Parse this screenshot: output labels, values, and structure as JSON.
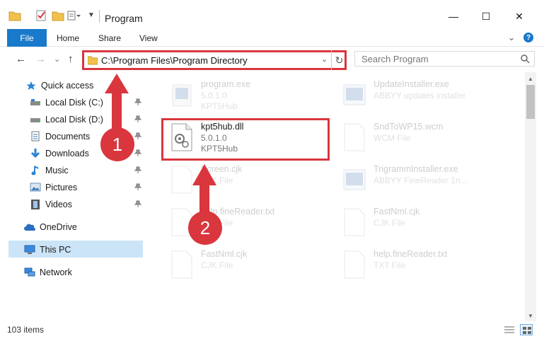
{
  "window": {
    "title": "Program",
    "minimize": "—",
    "maximize": "☐",
    "close": "✕"
  },
  "ribbon": {
    "tabs": [
      "File",
      "Home",
      "Share",
      "View"
    ],
    "expand": "⌄",
    "help": "?"
  },
  "nav": {
    "back": "←",
    "forward": "→",
    "recent": "⌄",
    "up": "↑",
    "address": "C:\\Program Files\\Program Directory",
    "address_dropdown": "⌄",
    "refresh": "↻",
    "search_placeholder": "Search Program"
  },
  "sidebar": {
    "quick_access": "Quick access",
    "items": [
      {
        "label": "Local Disk (C:)",
        "icon": "drive-icon"
      },
      {
        "label": "Local Disk (D:)",
        "icon": "drive-icon"
      },
      {
        "label": "Documents",
        "icon": "documents-icon"
      },
      {
        "label": "Downloads",
        "icon": "downloads-icon"
      },
      {
        "label": "Music",
        "icon": "music-icon"
      },
      {
        "label": "Pictures",
        "icon": "pictures-icon"
      },
      {
        "label": "Videos",
        "icon": "videos-icon"
      }
    ],
    "onedrive": "OneDrive",
    "thispc": "This PC",
    "network": "Network",
    "pin": "📌"
  },
  "files": {
    "left": [
      {
        "name": "program.exe",
        "line1": "5.0.1.0",
        "line2": "KPT5Hub"
      },
      {
        "name": "kpt5hub.dll",
        "line1": "5.0.1.0",
        "line2": "KPT5Hub"
      },
      {
        "name": "Screen.cjk",
        "line1": "CJK File",
        "line2": ""
      },
      {
        "name": "help.fineReader.txt",
        "line1": "TXT File",
        "line2": ""
      },
      {
        "name": "FastNml.cjk",
        "line1": "CJK File",
        "line2": ""
      }
    ],
    "right": [
      {
        "name": "UpdateInstaller.exe",
        "line1": "ABBYY updates installer",
        "line2": ""
      },
      {
        "name": "SndToWP15.wcm",
        "line1": "WCM File",
        "line2": ""
      },
      {
        "name": "TrigrammInstaller.exe",
        "line1": "ABBYY FineReader 1n...",
        "line2": ""
      },
      {
        "name": "FastNml.cjk",
        "line1": "CJK File",
        "line2": ""
      },
      {
        "name": "help.fineReader.txt",
        "line1": "TXT File",
        "line2": ""
      }
    ]
  },
  "status": {
    "items": "103 items"
  },
  "annotations": {
    "step1": "1",
    "step2": "2"
  },
  "colors": {
    "accent": "#1979ca",
    "highlight_red": "#d9363e",
    "selection": "#cce4f7"
  }
}
